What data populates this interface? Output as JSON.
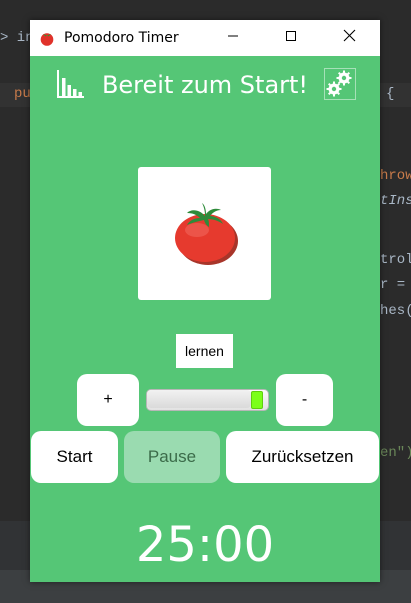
{
  "window": {
    "title": "Pomodoro Timer",
    "minimize_icon": "minimize-icon",
    "maximize_icon": "maximize-icon",
    "close_icon": "close-icon"
  },
  "header": {
    "status_text": "Bereit zum Start!",
    "stats_icon": "bar-chart-icon",
    "settings_icon": "gears-icon"
  },
  "main": {
    "image_icon": "tomato-icon",
    "mode_label": "lernen",
    "increase_label": "+",
    "decrease_label": "-",
    "duration_slider_fraction": 0.95,
    "slider_thumb_color": "#7cff1a"
  },
  "controls": {
    "start_label": "Start",
    "pause_label": "Pause",
    "reset_label": "Zurücksetzen"
  },
  "timer": {
    "display": "25:00"
  },
  "colors": {
    "background": "#55c676",
    "pause_disabled": "#9adbb0"
  },
  "ide_background": {
    "fragments": [
      "> in",
      "pu",
      "{",
      "hrow",
      "tIns",
      "trol",
      "r =",
      "hes(",
      "en\")"
    ]
  }
}
